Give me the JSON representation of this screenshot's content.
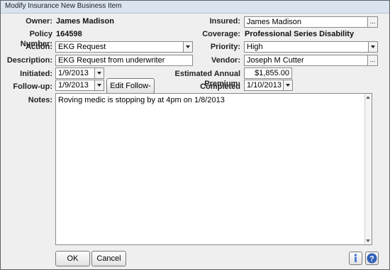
{
  "window": {
    "title": "Modify Insurance New Business Item"
  },
  "fields": {
    "owner": {
      "label": "Owner:",
      "value": "James Madison"
    },
    "insured": {
      "label": "Insured:",
      "value": "James Madison"
    },
    "policy_number": {
      "label": "Policy Number:",
      "value": "164598"
    },
    "coverage": {
      "label": "Coverage:",
      "value": "Professional Series Disability"
    },
    "action": {
      "label": "Action:",
      "value": "EKG Request"
    },
    "priority": {
      "label": "Priority:",
      "value": "High"
    },
    "description": {
      "label": "Description:",
      "value": "EKG Request from underwriter"
    },
    "vendor": {
      "label": "Vendor:",
      "value": "Joseph M Cutter"
    },
    "initiated": {
      "label": "Initiated:",
      "value": "1/9/2013"
    },
    "estimated_annual_premium": {
      "label": "Estimated Annual Premium:",
      "value": "$1,855.00"
    },
    "follow_up": {
      "label": "Follow-up:",
      "value": "1/9/2013"
    },
    "completed": {
      "label": "Completed",
      "value": "1/10/2013"
    },
    "notes": {
      "label": "Notes:",
      "value": "Roving medic is stopping by at 4pm on 1/8/2013"
    }
  },
  "buttons": {
    "edit_follow_up": "Edit Follow-up",
    "ok": "OK",
    "cancel": "Cancel",
    "ellipsis": "..."
  },
  "icons": {
    "info": "info-icon",
    "help": "help-icon",
    "dropdown": "chevron-down-icon"
  },
  "colors": {
    "help_blue": "#2f5fb8",
    "info_blue": "#3a6fd1"
  }
}
